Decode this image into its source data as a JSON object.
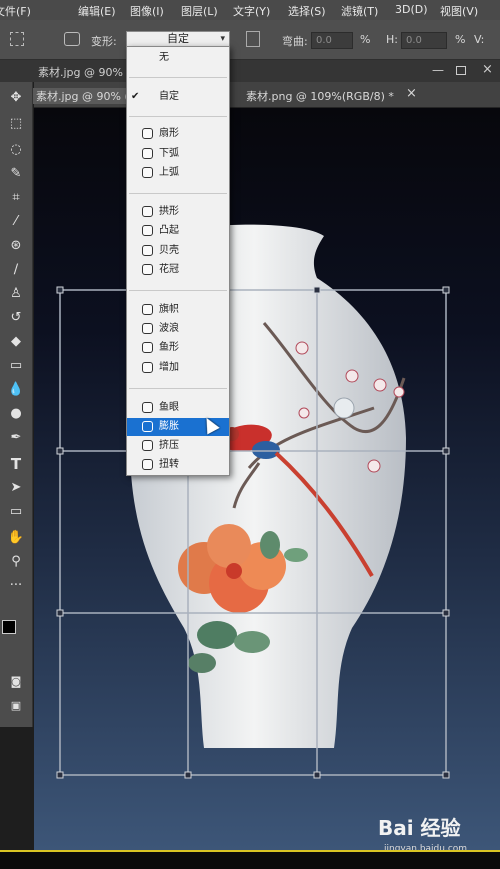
{
  "menubar": {
    "items": [
      "文件(F)",
      "编辑(E)",
      "图像(I)",
      "图层(L)",
      "文字(Y)",
      "选择(S)",
      "滤镜(T)",
      "3D(D)",
      "视图(V)"
    ]
  },
  "options": {
    "warp_label": "变形:",
    "warp_value": "自定",
    "bend_label": "弯曲:",
    "bend_value": "0.0",
    "percent": "%",
    "h_label": "H:",
    "h_value": "0.0",
    "v_label": "V:",
    "v_value": "0.0"
  },
  "tabs": {
    "back_tab": "素材.jpg @ 90%",
    "tab1": "素材.jpg @ 90% (",
    "tab2": "素材.png @ 109%(RGB/8) *",
    "tab2_close": "×"
  },
  "dropdown": {
    "items": [
      {
        "label": "无",
        "icon": "",
        "checked": false,
        "selected": false
      },
      {
        "label": "自定",
        "icon": "",
        "checked": true,
        "selected": false
      },
      {
        "label": "扇形",
        "icon": "arc-icon",
        "checked": false,
        "selected": false
      },
      {
        "label": "下弧",
        "icon": "arc-lower-icon",
        "checked": false,
        "selected": false
      },
      {
        "label": "上弧",
        "icon": "arc-upper-icon",
        "checked": false,
        "selected": false
      },
      {
        "label": "拱形",
        "icon": "arch-icon",
        "checked": false,
        "selected": false
      },
      {
        "label": "凸起",
        "icon": "bulge-icon",
        "checked": false,
        "selected": false
      },
      {
        "label": "贝壳",
        "icon": "shell-icon",
        "checked": false,
        "selected": false
      },
      {
        "label": "花冠",
        "icon": "flag-icon",
        "checked": false,
        "selected": false
      },
      {
        "label": "旗帜",
        "icon": "banner-icon",
        "checked": false,
        "selected": false
      },
      {
        "label": "波浪",
        "icon": "wave-icon",
        "checked": false,
        "selected": false
      },
      {
        "label": "鱼形",
        "icon": "fish-icon",
        "checked": false,
        "selected": false
      },
      {
        "label": "增加",
        "icon": "rise-icon",
        "checked": false,
        "selected": false
      },
      {
        "label": "鱼眼",
        "icon": "fisheye-icon",
        "checked": false,
        "selected": false
      },
      {
        "label": "膨胀",
        "icon": "inflate-icon",
        "checked": false,
        "selected": true
      },
      {
        "label": "挤压",
        "icon": "squeeze-icon",
        "checked": false,
        "selected": false
      },
      {
        "label": "扭转",
        "icon": "twist-icon",
        "checked": false,
        "selected": false
      }
    ],
    "checkmark": "✔"
  },
  "watermark": {
    "logo": "Bai 经验",
    "url": "jingyan.baidu.com"
  },
  "colors": {
    "menu_bg": "#4a4a4a",
    "toolbar_bg": "#4c4c4c",
    "selection": "#1a71d1",
    "taskbar_accent": "#d8c424"
  }
}
